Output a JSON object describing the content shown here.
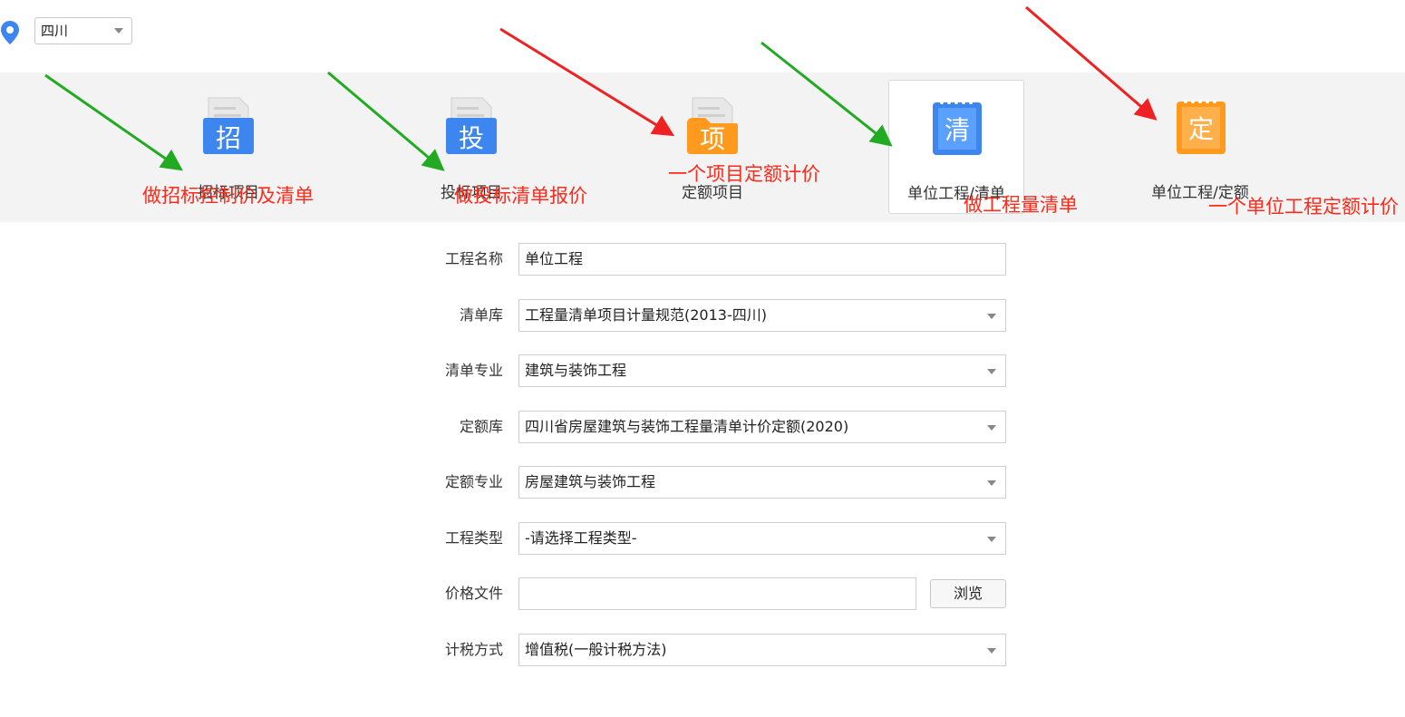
{
  "region": {
    "selected": "四川"
  },
  "project_types": [
    {
      "label": "招标项目",
      "glyph": "招",
      "color": "#3d86f0",
      "icon": "document-icon"
    },
    {
      "label": "投标项目",
      "glyph": "投",
      "color": "#3d86f0",
      "icon": "document-icon"
    },
    {
      "label": "定额项目",
      "glyph": "项",
      "color": "#ff9a1f",
      "icon": "document-icon"
    },
    {
      "label": "单位工程/清单",
      "glyph": "清",
      "color": "#3d86f0",
      "icon": "notebook-icon",
      "selected": true
    },
    {
      "label": "单位工程/定额",
      "glyph": "定",
      "color": "#ff9a1f",
      "icon": "notebook-icon"
    }
  ],
  "annotations": [
    {
      "text": "做招标控制价及清单",
      "arrow_color": "#22aa22"
    },
    {
      "text": "做投标清单报价",
      "arrow_color": "#22aa22"
    },
    {
      "text": "一个项目定额计价",
      "arrow_color": "#ee2222"
    },
    {
      "text": "做工程量清单",
      "arrow_color": "#22aa22"
    },
    {
      "text": "一个单位工程定额计价",
      "arrow_color": "#ee2222"
    }
  ],
  "form": {
    "project_name": {
      "label": "工程名称",
      "value": "单位工程"
    },
    "bill_library": {
      "label": "清单库",
      "value": "工程量清单项目计量规范(2013-四川)"
    },
    "bill_specialty": {
      "label": "清单专业",
      "value": "建筑与装饰工程"
    },
    "quota_library": {
      "label": "定额库",
      "value": "四川省房屋建筑与装饰工程量清单计价定额(2020)"
    },
    "quota_specialty": {
      "label": "定额专业",
      "value": "房屋建筑与装饰工程"
    },
    "project_type": {
      "label": "工程类型",
      "value": "-请选择工程类型-"
    },
    "price_file": {
      "label": "价格文件",
      "value": "",
      "browse": "浏览"
    },
    "tax_method": {
      "label": "计税方式",
      "value": "增值税(一般计税方法)"
    }
  }
}
